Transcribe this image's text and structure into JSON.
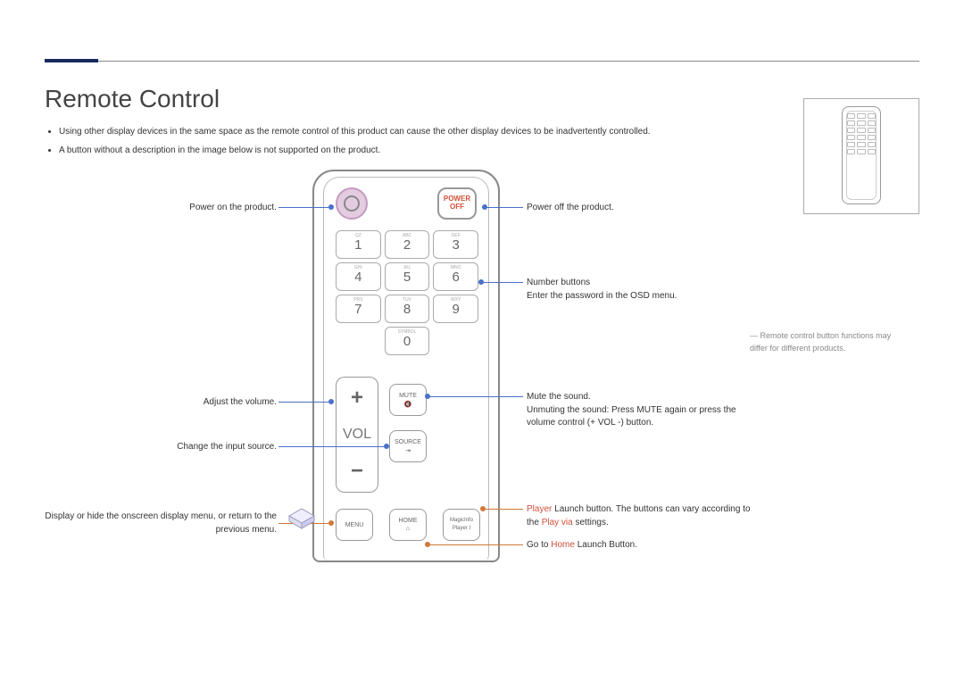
{
  "title": "Remote Control",
  "bullets": [
    "Using other display devices in the same space as the remote control of this product can cause the other display devices to be inadvertently controlled.",
    "A button without a description in the image below is not supported on the product."
  ],
  "left": {
    "power_on": "Power on the product.",
    "volume": "Adjust the volume.",
    "source": "Change the input source.",
    "menu": "Display or hide the onscreen display menu, or return to the previous menu."
  },
  "right": {
    "power_off": "Power off the product.",
    "numbers_title": "Number buttons",
    "numbers_body": "Enter the password in the OSD menu.",
    "mute_title": "Mute the sound.",
    "mute_body1": "Unmuting the sound: Press ",
    "mute_key": "MUTE",
    "mute_body2": " again or press the volume control (+ VOL -) button.",
    "player1": "Player",
    "player2": " Launch button. The buttons can vary according to the ",
    "player3": "Play via",
    "player4": " settings.",
    "home1": "Go to ",
    "home2": "Home",
    "home3": " Launch Button."
  },
  "footnote": "Remote control button functions may differ for different products.",
  "remote": {
    "poweroff1": "POWER",
    "poweroff2": "OFF",
    "keys": [
      [
        "QZ",
        "1"
      ],
      [
        "ABC",
        "2"
      ],
      [
        "DEF",
        "3"
      ],
      [
        "GHI",
        "4"
      ],
      [
        "JKL",
        "5"
      ],
      [
        "MNO",
        "6"
      ],
      [
        "PRS",
        "7"
      ],
      [
        "TUV",
        "8"
      ],
      [
        "WXY",
        "9"
      ],
      [
        "SYMBOL",
        "0"
      ]
    ],
    "vol": "VOL",
    "mute": "MUTE",
    "source": "SOURCE",
    "menu": "MENU",
    "home": "HOME",
    "magic1": "MagicInfo",
    "magic2": "Player I"
  }
}
